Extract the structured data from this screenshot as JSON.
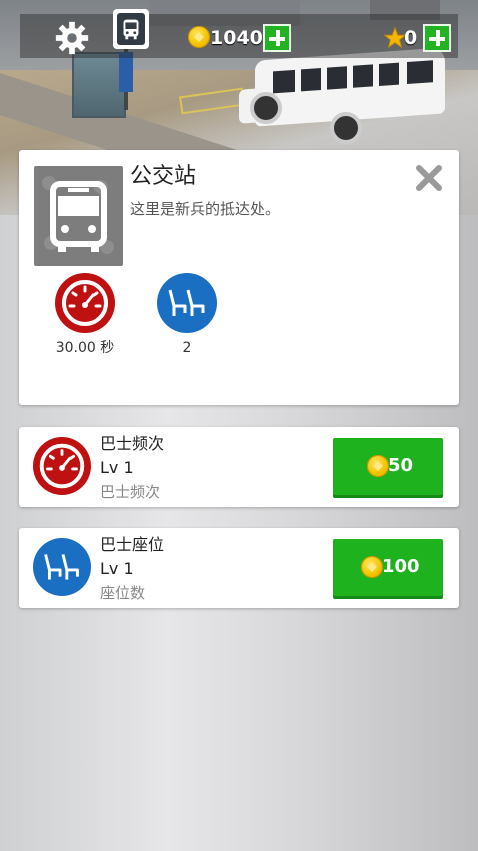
{
  "hud": {
    "coins": "1040",
    "stars": "0",
    "icons": [
      "gear-icon",
      "bus-stop-icon",
      "coin-icon",
      "plus-icon",
      "star-icon"
    ]
  },
  "info_panel": {
    "title": "公交站",
    "description": "这里是新兵的抵达处。",
    "stats": [
      {
        "icon": "speedometer-icon",
        "value": "30.00 秒",
        "color": "#bf1111"
      },
      {
        "icon": "seat-icon",
        "value": "2",
        "color": "#1a6fc2"
      }
    ]
  },
  "upgrades": [
    {
      "name": "巴士频次",
      "level": "Lv 1",
      "subtitle": "巴士频次",
      "price": "50",
      "icon": "speedometer-icon"
    },
    {
      "name": "巴士座位",
      "level": "Lv 1",
      "subtitle": "座位数",
      "price": "100",
      "icon": "seat-icon"
    }
  ],
  "colors": {
    "buy_button": "#1fb21f",
    "accent_red": "#bf1111",
    "accent_blue": "#1a6fc2"
  }
}
